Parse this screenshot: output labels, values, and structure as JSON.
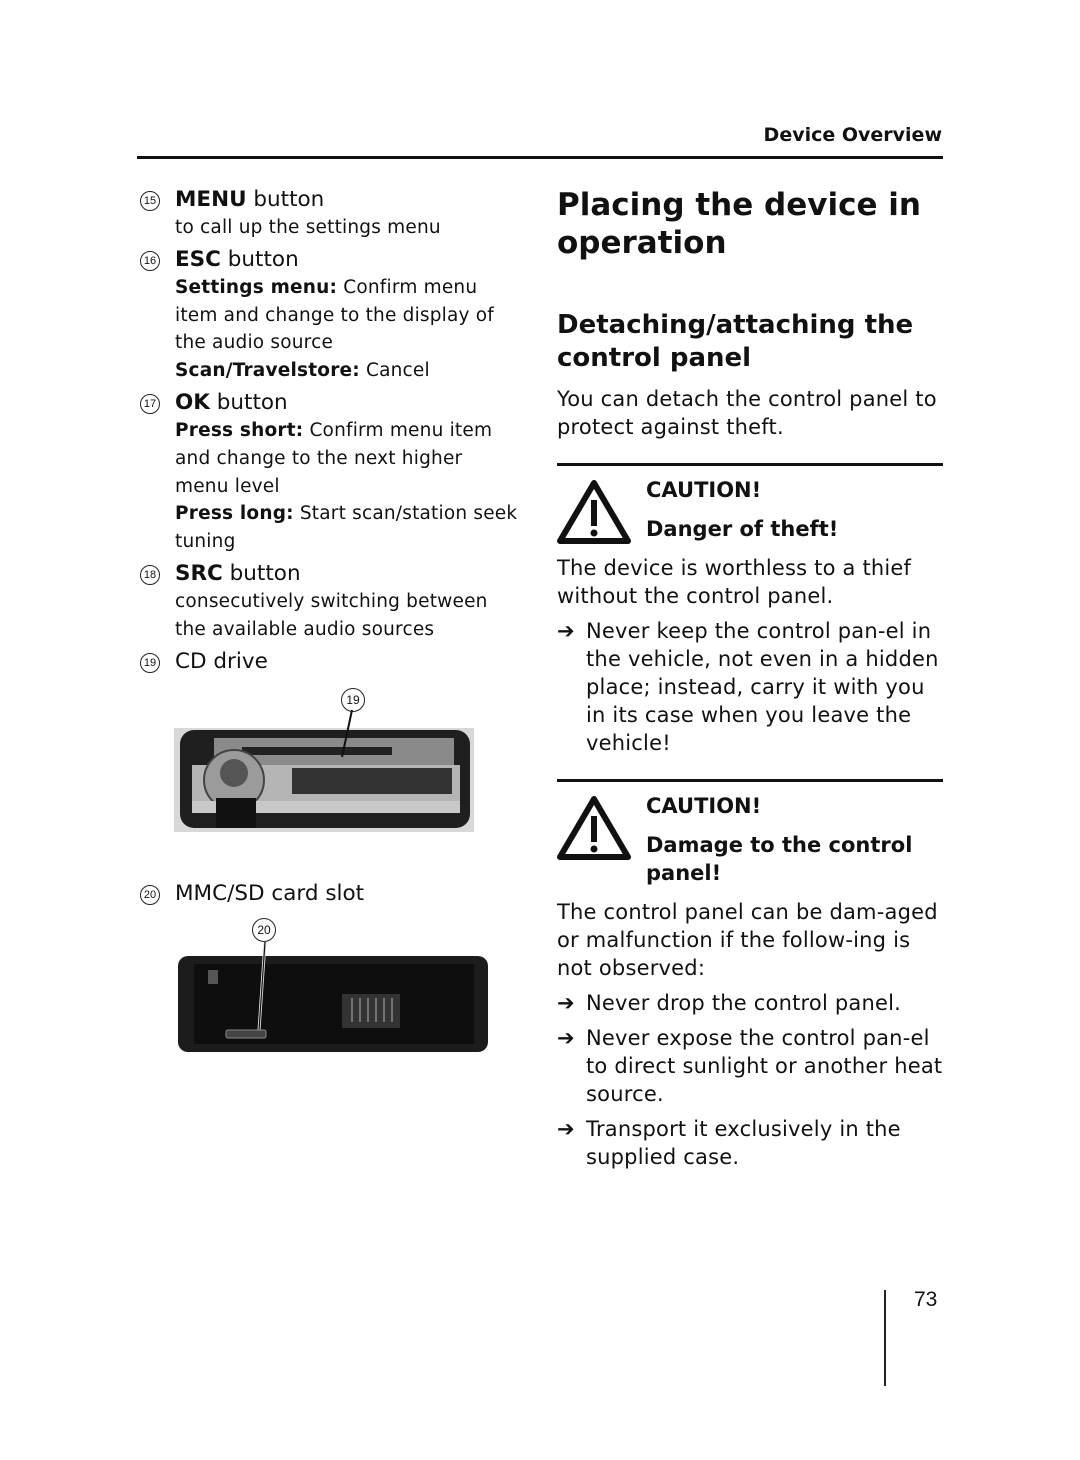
{
  "header": {
    "running_title": "Device Overview"
  },
  "left": {
    "items": [
      {
        "num": "15",
        "bold": "MENU",
        "rest": " button",
        "desc": [
          {
            "b": "",
            "t": "to call up the settings menu"
          }
        ]
      },
      {
        "num": "16",
        "bold": "ESC",
        "rest": " button",
        "desc": [
          {
            "b": "Settings menu:",
            "t": " Confirm menu item and change to the display of the audio source"
          },
          {
            "b": "Scan/Travelstore:",
            "t": " Cancel"
          }
        ]
      },
      {
        "num": "17",
        "bold": "OK",
        "rest": " button",
        "desc": [
          {
            "b": "Press short:",
            "t": " Confirm menu item and change to the next higher menu level"
          },
          {
            "b": "Press long:",
            "t": " Start scan/station seek tuning"
          }
        ]
      },
      {
        "num": "18",
        "bold": "SRC",
        "rest": " button",
        "desc": [
          {
            "b": "",
            "t": "consecutively switching between the available audio sources"
          }
        ]
      },
      {
        "num": "19",
        "bold": "",
        "rest": "CD drive",
        "desc": []
      },
      {
        "num": "20",
        "bold": "",
        "rest": "MMC/SD card slot",
        "desc": []
      }
    ],
    "figure_cd": {
      "callout": "19"
    },
    "figure_sd": {
      "callout": "20"
    }
  },
  "right": {
    "title": "Placing the device in operation",
    "subtitle": "Detaching/attaching the control panel",
    "intro": "You can detach the control panel to protect against theft.",
    "cautions": [
      {
        "label": "CAUTION!",
        "heading": "Danger of theft!",
        "text": "The device is worthless to a thief without the control panel.",
        "bullets": [
          "Never keep the control pan-el in the vehicle, not even in a hidden place; instead, carry it with you in its case when you leave the vehicle!"
        ]
      },
      {
        "label": "CAUTION!",
        "heading": "Damage to the control panel!",
        "text": "The control panel can be dam-aged or malfunction if the follow-ing is not observed:",
        "bullets": [
          "Never drop the control panel.",
          "Never expose the control pan-el to direct sunlight or another heat source.",
          "Transport it exclusively in the supplied case."
        ]
      }
    ]
  },
  "footer": {
    "page_number": "73"
  }
}
